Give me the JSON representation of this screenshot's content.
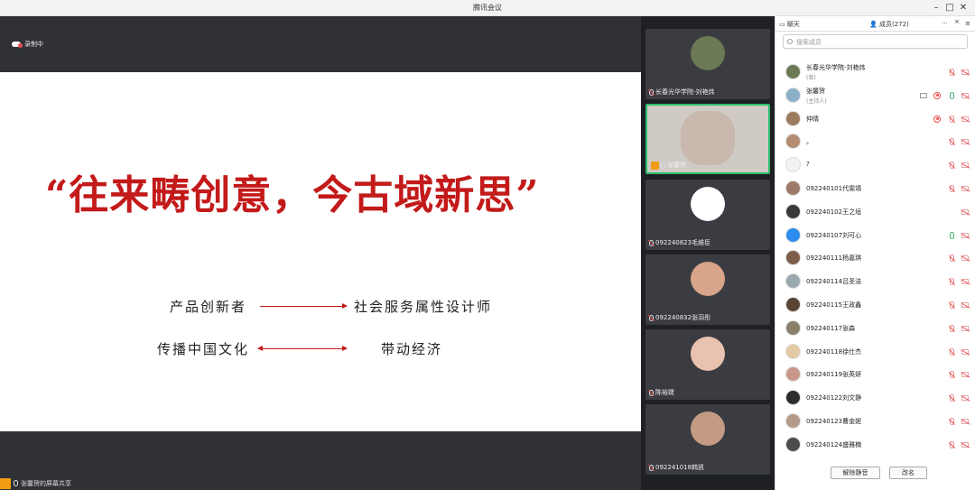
{
  "window": {
    "title": "腾讯会议",
    "minimize": "–",
    "maximize": "□",
    "close": "✕"
  },
  "main": {
    "recording_label": "录制中",
    "slide": {
      "title": "“往来畴创意，今古域新思”",
      "row1_left": "产品创新者",
      "row1_right": "社会服务属性设计师",
      "row2_left": "传播中国文化",
      "row2_right": "带动经济"
    },
    "share_label": "张馨贺的屏幕共享"
  },
  "video_strip": [
    {
      "name": "长春光华学院-刘艳炜",
      "avatar_color": "#6b7a55",
      "mic": "off"
    },
    {
      "name": "张馨贺",
      "avatar_color": "#c9b8ad",
      "mic": "on",
      "active": true
    },
    {
      "name": "092240823毛維臣",
      "avatar_color": "#ffffff",
      "mic": "off"
    },
    {
      "name": "092240832张羽彤",
      "avatar_color": "#d8a48a",
      "mic": "off"
    },
    {
      "name": "陈裕婕",
      "avatar_color": "#e9c3b0",
      "mic": "off"
    },
    {
      "name": "092241018韩凯",
      "avatar_color": "#c29b82",
      "mic": "off"
    }
  ],
  "panel": {
    "tab_chat": "聊天",
    "tab_members": "成员(272)",
    "more": "···",
    "close": "×",
    "search_placeholder": "搜索成员",
    "members": [
      {
        "name": "长春光华学院-刘艳炜",
        "role": "(我)",
        "avatar": "#6b7a55",
        "mic": "off"
      },
      {
        "name": "张馨贺",
        "role": "(主持人)",
        "avatar": "#8ab0c8",
        "mic": "on",
        "screen": true,
        "rec": true
      },
      {
        "name": "仲晴",
        "role": "",
        "avatar": "#9c7c5e",
        "mic": "off",
        "rec": true
      },
      {
        "name": "。",
        "role": "",
        "avatar": "#b38c72",
        "mic": "off"
      },
      {
        "name": "?",
        "role": "",
        "avatar": "#f2f2f2",
        "mic": "off"
      },
      {
        "name": "092240101代雯靖",
        "role": "",
        "avatar": "#a07a68",
        "mic": "off"
      },
      {
        "name": "092240102王之垣",
        "role": "",
        "avatar": "#3a3a3a",
        "mic": "none"
      },
      {
        "name": "092240107刘可心",
        "role": "",
        "avatar": "#2d8cf0",
        "mic": "on"
      },
      {
        "name": "092240111杨嘉琪",
        "role": "",
        "avatar": "#7d5e4a",
        "mic": "off"
      },
      {
        "name": "092240114吕圣洁",
        "role": "",
        "avatar": "#9ba8b0",
        "mic": "off"
      },
      {
        "name": "092240115王政鑫",
        "role": "",
        "avatar": "#5a4434",
        "mic": "off"
      },
      {
        "name": "092240117张森",
        "role": "",
        "avatar": "#8a7f6a",
        "mic": "off"
      },
      {
        "name": "092240118徐仕杰",
        "role": "",
        "avatar": "#e3c9a4",
        "mic": "off"
      },
      {
        "name": "092240119张英妍",
        "role": "",
        "avatar": "#c8968a",
        "mic": "off"
      },
      {
        "name": "092240122刘文静",
        "role": "",
        "avatar": "#2c2c2c",
        "mic": "off"
      },
      {
        "name": "092240123曹金妮",
        "role": "",
        "avatar": "#b49a88",
        "mic": "off"
      },
      {
        "name": "092240124盛雅楠",
        "role": "",
        "avatar": "#4c4c4c",
        "mic": "off"
      }
    ],
    "btn_unmute_all": "解除静音",
    "btn_rename": "改名"
  }
}
